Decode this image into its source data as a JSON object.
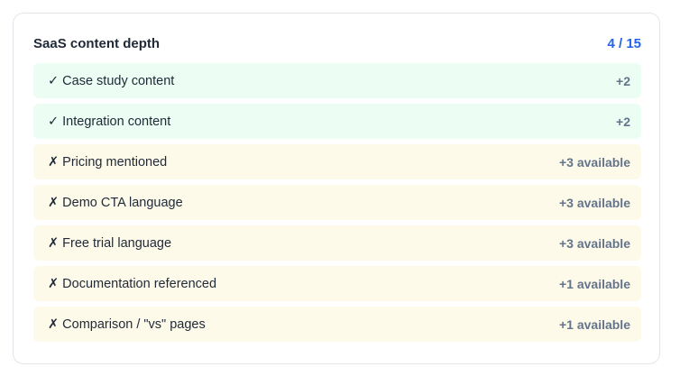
{
  "card": {
    "title": "SaaS content depth",
    "score": "4 / 15"
  },
  "colors": {
    "done_bg": "#ecfdf3",
    "missing_bg": "#fefaea",
    "accent": "#2563eb"
  },
  "items": [
    {
      "mark": "✓",
      "label": "Case study content",
      "points": "+2",
      "status": "done",
      "icon": "check-icon"
    },
    {
      "mark": "✓",
      "label": "Integration content",
      "points": "+2",
      "status": "done",
      "icon": "check-icon"
    },
    {
      "mark": "✗",
      "label": "Pricing mentioned",
      "points": "+3 available",
      "status": "missing",
      "icon": "cross-icon"
    },
    {
      "mark": "✗",
      "label": "Demo CTA language",
      "points": "+3 available",
      "status": "missing",
      "icon": "cross-icon"
    },
    {
      "mark": "✗",
      "label": "Free trial language",
      "points": "+3 available",
      "status": "missing",
      "icon": "cross-icon"
    },
    {
      "mark": "✗",
      "label": "Documentation referenced",
      "points": "+1 available",
      "status": "missing",
      "icon": "cross-icon"
    },
    {
      "mark": "✗",
      "label": "Comparison / \"vs\" pages",
      "points": "+1 available",
      "status": "missing",
      "icon": "cross-icon"
    }
  ]
}
